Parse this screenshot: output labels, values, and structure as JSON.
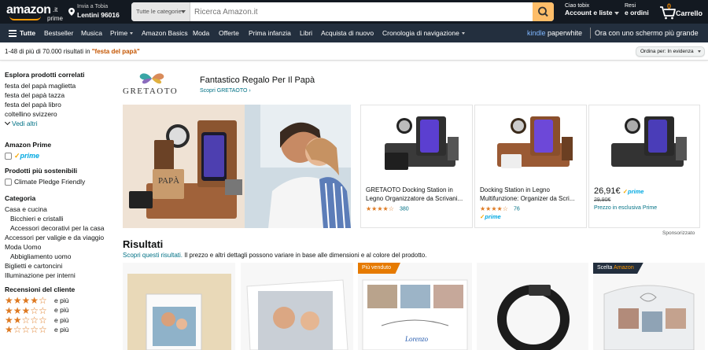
{
  "header": {
    "logo": {
      "word": "amazon",
      "tld": ".it",
      "prime": "prime"
    },
    "deliver": {
      "line1": "Invia a Tobia",
      "line2": "Lentini 96016"
    },
    "search": {
      "category": "Tutte le categorie",
      "placeholder": "Ricerca Amazon.it"
    },
    "account": {
      "line1": "Ciao tobix",
      "line2": "Account e liste"
    },
    "orders": {
      "line1": "Resi",
      "line2": "e ordini"
    },
    "cart": {
      "count": "0",
      "label": "Carrello"
    }
  },
  "nav": {
    "all": "Tutte",
    "items": [
      "Bestseller",
      "Musica",
      "Prime",
      "Amazon Basics",
      "Moda",
      "Offerte",
      "Prima infanzia",
      "Libri",
      "Acquista di nuovo",
      "Cronologia di navigazione"
    ],
    "kindle": {
      "brand_k": "kindle",
      "brand_p": "paperwhite",
      "tagline": "Ora con uno schermo più grande"
    }
  },
  "results_bar": {
    "prefix": "1-48 di più di 70.000 risultati in",
    "query": "\"festa del papà\"",
    "sort_label": "Ordina per:",
    "sort_value": "In evidenza"
  },
  "sidebar": {
    "related_title": "Esplora prodotti correlati",
    "related": [
      "festa del papà maglietta",
      "festa del papà tazza",
      "festa del papà libro",
      "coltellino svizzero"
    ],
    "more": "Vedi altri",
    "prime_title": "Amazon Prime",
    "prime_logo": "prime",
    "sustainable_title": "Prodotti più sostenibili",
    "sustainable_item": "Climate Pledge Friendly",
    "category_title": "Categoria",
    "categories": [
      {
        "label": "Casa e cucina",
        "indent": false
      },
      {
        "label": "Bicchieri e cristalli",
        "indent": true
      },
      {
        "label": "Accessori decorativi per la casa",
        "indent": true
      },
      {
        "label": "Accessori per valigie e da viaggio",
        "indent": false
      },
      {
        "label": "Moda Uomo",
        "indent": false
      },
      {
        "label": "Abbigliamento uomo",
        "indent": true
      },
      {
        "label": "Biglietti e cartoncini",
        "indent": false
      },
      {
        "label": "Illuminazione per interni",
        "indent": false
      }
    ],
    "reviews_title": "Recensioni del cliente",
    "reviews": [
      {
        "stars": 4,
        "label": "e più"
      },
      {
        "stars": 3,
        "label": "e più"
      },
      {
        "stars": 2,
        "label": "e più"
      },
      {
        "stars": 1,
        "label": "e più"
      }
    ]
  },
  "brand": {
    "logo_text": "GRETAOTO",
    "title": "Fantastico Regalo Per Il Papà",
    "shop_link": "Scopri GRETAOTO ›"
  },
  "products": [
    {
      "title": "GRETAOTO Docking Station in Legno Organizzatore da Scrivani...",
      "rating": 4.5,
      "count": "380",
      "prime": false
    },
    {
      "title": "Docking Station in Legno Multifunzione: Organizer da Scri...",
      "rating": 4.5,
      "count": "76",
      "prime": true,
      "prime_label": "prime"
    },
    {
      "price": "26,91€",
      "prime_label": "prime",
      "old_price": "29,90€",
      "exclusive": "Prezzo in esclusiva Prime"
    }
  ],
  "sponsored": "Sponsorizzato",
  "results": {
    "heading": "Risultati",
    "link": "Scopri questi risultati.",
    "note": "Il prezzo e altri dettagli possono variare in base alle dimensioni e al colore del prodotto."
  },
  "tiles": [
    {
      "badge": ""
    },
    {
      "badge": ""
    },
    {
      "badge": "Più venduto",
      "badge_style": "orange"
    },
    {
      "badge": ""
    },
    {
      "badge_prefix": "Scelta",
      "badge_brand": "Amazon",
      "badge_style": "dark"
    }
  ],
  "colors": {
    "header": "#131921",
    "subnav": "#232f3e",
    "accent": "#ff9900",
    "search_btn": "#febd69",
    "link": "#007185",
    "query": "#c45500",
    "star": "#de7921"
  }
}
